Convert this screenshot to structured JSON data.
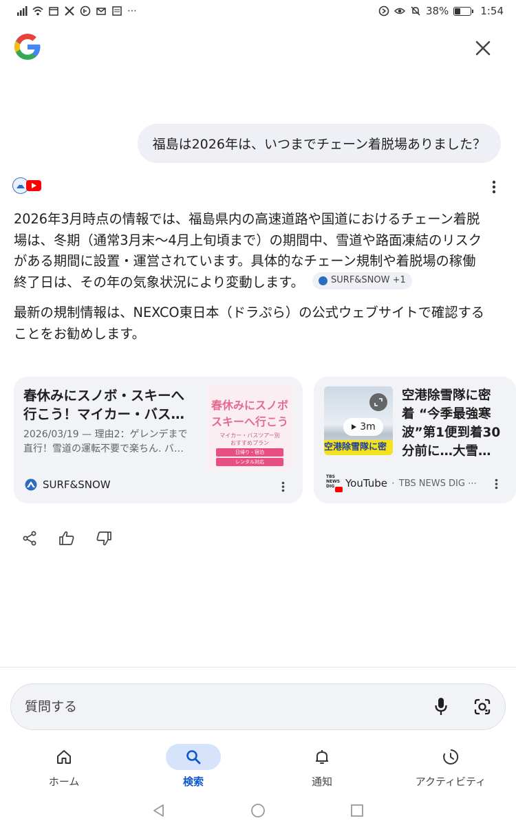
{
  "status_bar": {
    "battery": "38%",
    "time": "1:54",
    "battery_level": 0.38
  },
  "chat": {
    "query": "福島は2026年は、いつまでチェーン着脱場ありました？",
    "answer_p1_line1": "2026年3月時点の情報では、福島県内の高速道路や国道におけるチェーン着脱",
    "answer_p1_line2": "場は、冬期（通常3月末〜4月上旬頃まで）の期間中、雪道や路面凍結のリスク",
    "answer_p1_line3": "がある期間に設置・運営されています。具体的なチェーン規制や着脱場の稼働",
    "answer_p1_line4": "終了日は、その年の気象状況により変動します。",
    "source_chip": "SURF&SNOW +1",
    "answer_p2_line1": "最新の規制情報は、NEXCO東日本（ドラぷら）の公式ウェブサイトで確認する",
    "answer_p2_line2": "ことをお勧めします。"
  },
  "cards": [
    {
      "title_line1": "春休みにスノボ・スキーへ",
      "title_line2": "行こう！マイカー・バス…",
      "date": "2026/03/19",
      "snippet_line1": " — 理由2：ゲレンデまで",
      "snippet_line2": "直行！雪道の運転不要で楽ちん. バ…",
      "thumb_line1": "春休みにスノボ",
      "thumb_line2": "スキーへ行こう",
      "thumb_line3": "マイカー・バスツアー別",
      "thumb_line4": "おすすめプラン",
      "thumb_line5": "日帰り・宿泊",
      "thumb_line6": "レンタル対応",
      "source": "SURF&SNOW"
    },
    {
      "title_line1": "空港除雪隊に密",
      "title_line2": "着 “今季最強寒",
      "title_line3": "波”第1便到着30",
      "title_line4": "分前に…大雪…",
      "duration": "3m",
      "thumb_caption": "空港除雪隊に密",
      "source": "YouTube",
      "channel": "TBS NEWS DIG ⋯",
      "channel_logo_line1": "TBS",
      "channel_logo_line2": "NEWS",
      "channel_logo_line3": "DIG"
    }
  ],
  "ask_bar": {
    "placeholder": "質問する"
  },
  "bottom_nav": [
    {
      "label": "ホーム",
      "icon": "home-icon"
    },
    {
      "label": "検索",
      "icon": "search-icon",
      "active": true
    },
    {
      "label": "通知",
      "icon": "bell-icon"
    },
    {
      "label": "アクティビティ",
      "icon": "activity-icon"
    }
  ],
  "colors": {
    "accent": "#0b57d0",
    "active_pill": "#d7e3fb",
    "card_bg": "#f1f3f7"
  }
}
